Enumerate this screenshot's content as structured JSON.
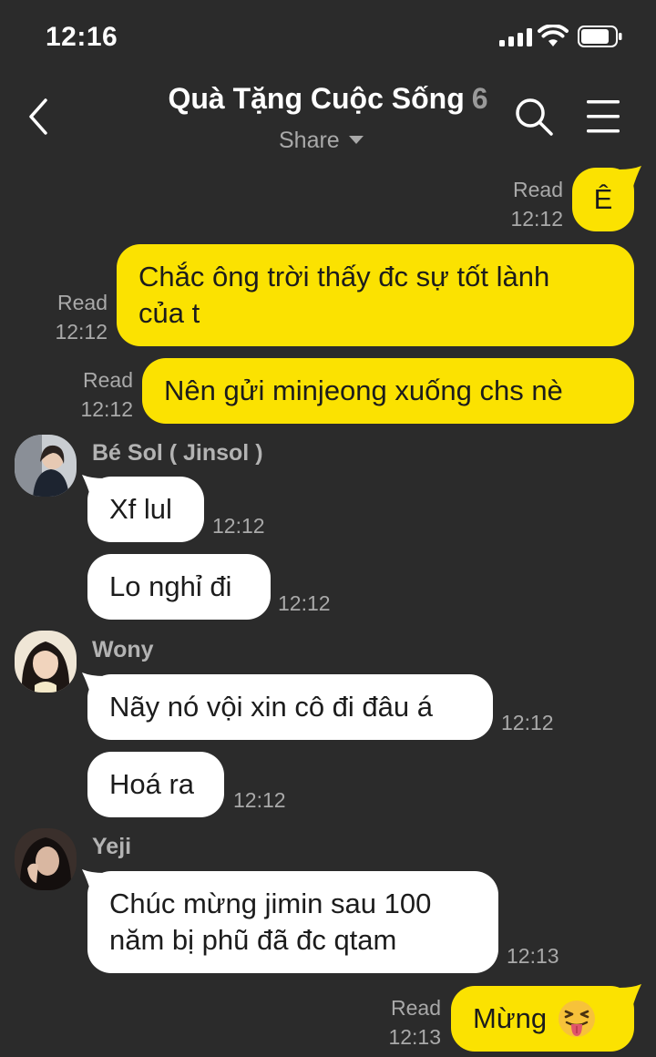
{
  "status": {
    "time": "12:16"
  },
  "header": {
    "title": "Quà Tặng Cuộc Sống",
    "member_count": "6",
    "share_label": "Share"
  },
  "messages": [
    {
      "side": "mine",
      "text": "Ê",
      "read": "Read",
      "time": "12:12"
    },
    {
      "side": "mine",
      "text_lines": [
        "Chắc ông trời thấy đc sự tốt lành",
        "của t"
      ],
      "read": "Read",
      "time": "12:12"
    },
    {
      "side": "mine",
      "text": "Nên gửi minjeong xuống chs nè",
      "read": "Read",
      "time": "12:12"
    },
    {
      "side": "theirs",
      "sender": "Bé Sol ( Jinsol )",
      "text": "Xf lul",
      "time": "12:12"
    },
    {
      "side": "theirs",
      "text": "Lo nghỉ đi",
      "time": "12:12"
    },
    {
      "side": "theirs",
      "sender": "Wony",
      "text": "Nãy nó vội xin cô đi đâu á",
      "time": "12:12"
    },
    {
      "side": "theirs",
      "text": "Hoá ra",
      "time": "12:12"
    },
    {
      "side": "theirs",
      "sender": "Yeji",
      "text_lines": [
        "Chúc mừng jimin sau 100",
        "năm bị phũ đã đc qtam"
      ],
      "time": "12:13"
    },
    {
      "side": "mine",
      "text": "Mừng",
      "emoji": "squinting-tongue-face",
      "read": "Read",
      "time": "12:13"
    }
  ],
  "colors": {
    "background": "#2b2b2b",
    "my_bubble": "#fbe201",
    "their_bubble": "#ffffff",
    "meta_text": "#a9a9a9"
  }
}
